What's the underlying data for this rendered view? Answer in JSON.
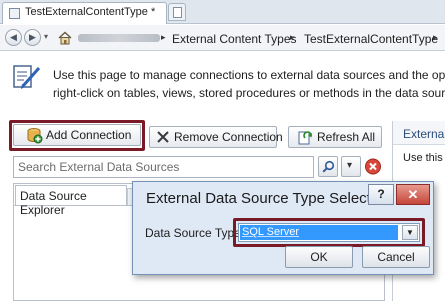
{
  "tab": {
    "title": "TestExternalContentType *"
  },
  "breadcrumb": {
    "items": [
      "External Content Types",
      "TestExternalContentType"
    ],
    "separator": "▸"
  },
  "info": {
    "line1": "Use this page to manage connections to external data sources and the operations",
    "line2": "right-click on tables, views, stored procedures or methods in the data source expl"
  },
  "toolbar": {
    "add_connection": "Add Connection",
    "remove_connection": "Remove Connection",
    "refresh_all": "Refresh All"
  },
  "search": {
    "placeholder": "Search External Data Sources"
  },
  "explorer": {
    "tab_label": "Data Source Explorer"
  },
  "right_pane": {
    "header": "Externa",
    "text": "Use this"
  },
  "dialog": {
    "title": "External Data Source Type Selection",
    "help_label": "?",
    "close_label": "✕",
    "field_label": "Data Source Type",
    "selected_value": "SQL Server",
    "ok_label": "OK",
    "cancel_label": "Cancel"
  },
  "colors": {
    "highlight": "#7a1a26",
    "selection": "#3399ff",
    "dialog_bg": "#dfe9f5"
  }
}
